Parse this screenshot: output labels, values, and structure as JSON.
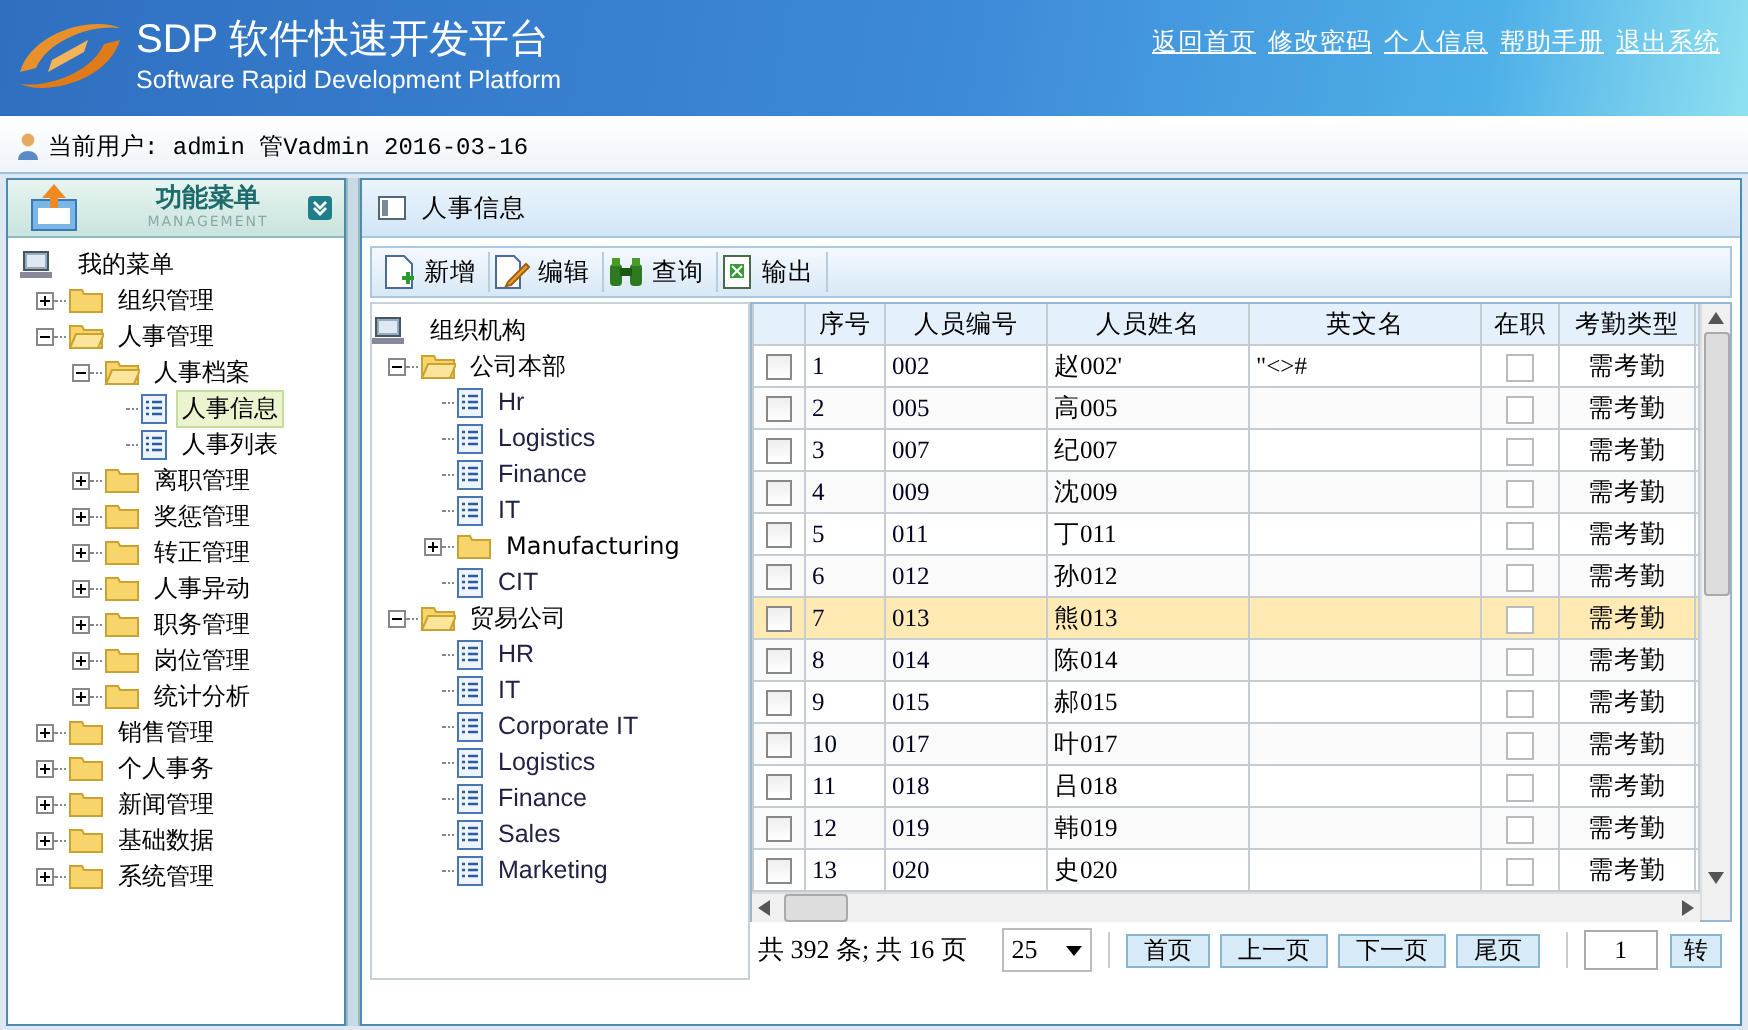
{
  "header": {
    "title": "SDP 软件快速开发平台",
    "subtitle": "Software Rapid Development Platform",
    "links": [
      "返回首页",
      "修改密码",
      "个人信息",
      "帮助手册",
      "退出系统"
    ]
  },
  "user_bar": {
    "text": "当前用户: admin 管Vadmin 2016-03-16"
  },
  "menu": {
    "title": "功能菜单",
    "subtitle": "MANAGEMENT",
    "root": "我的菜单",
    "items": [
      {
        "label": "组织管理",
        "kind": "folder",
        "expanded": false,
        "selected": false
      },
      {
        "label": "人事管理",
        "kind": "folder",
        "expanded": true,
        "selected": false,
        "children": [
          {
            "label": "人事档案",
            "kind": "folder",
            "expanded": true,
            "selected": false,
            "children": [
              {
                "label": "人事信息",
                "kind": "page",
                "selected": true
              },
              {
                "label": "人事列表",
                "kind": "page",
                "selected": false
              }
            ]
          },
          {
            "label": "离职管理",
            "kind": "folder",
            "expanded": false,
            "selected": false
          },
          {
            "label": "奖惩管理",
            "kind": "folder",
            "expanded": false,
            "selected": false
          },
          {
            "label": "转正管理",
            "kind": "folder",
            "expanded": false,
            "selected": false
          },
          {
            "label": "人事异动",
            "kind": "folder",
            "expanded": false,
            "selected": false
          },
          {
            "label": "职务管理",
            "kind": "folder",
            "expanded": false,
            "selected": false
          },
          {
            "label": "岗位管理",
            "kind": "folder",
            "expanded": false,
            "selected": false
          },
          {
            "label": "统计分析",
            "kind": "folder",
            "expanded": false,
            "selected": false
          }
        ]
      },
      {
        "label": "销售管理",
        "kind": "folder",
        "expanded": false,
        "selected": false
      },
      {
        "label": "个人事务",
        "kind": "folder",
        "expanded": false,
        "selected": false
      },
      {
        "label": "新闻管理",
        "kind": "folder",
        "expanded": false,
        "selected": false
      },
      {
        "label": "基础数据",
        "kind": "folder",
        "expanded": false,
        "selected": false
      },
      {
        "label": "系统管理",
        "kind": "folder",
        "expanded": false,
        "selected": false
      }
    ]
  },
  "panel": {
    "title": "人事信息",
    "toolbar": [
      {
        "label": "新增",
        "kind": "add"
      },
      {
        "label": "编辑",
        "kind": "edit"
      },
      {
        "label": "查询",
        "kind": "search"
      },
      {
        "label": "输出",
        "kind": "export"
      }
    ],
    "org_tree": {
      "root": "组织机构",
      "items": [
        {
          "label": "公司本部",
          "kind": "folder",
          "expanded": true,
          "selected": false,
          "children": [
            {
              "label": "Hr",
              "kind": "page",
              "selected": false
            },
            {
              "label": "Logistics",
              "kind": "page",
              "selected": false
            },
            {
              "label": "Finance",
              "kind": "page",
              "selected": false
            },
            {
              "label": "IT",
              "kind": "page",
              "selected": false
            },
            {
              "label": "Manufacturing",
              "kind": "folder",
              "expanded": false,
              "selected": false
            },
            {
              "label": "CIT",
              "kind": "page",
              "selected": false
            }
          ]
        },
        {
          "label": "贸易公司",
          "kind": "folder",
          "expanded": true,
          "selected": false,
          "children": [
            {
              "label": "HR",
              "kind": "page",
              "selected": false
            },
            {
              "label": "IT",
              "kind": "page",
              "selected": false
            },
            {
              "label": "Corporate IT",
              "kind": "page",
              "selected": false
            },
            {
              "label": "Logistics",
              "kind": "page",
              "selected": false
            },
            {
              "label": "Finance",
              "kind": "page",
              "selected": false
            },
            {
              "label": "Sales",
              "kind": "page",
              "selected": false
            },
            {
              "label": "Marketing",
              "kind": "page",
              "selected": false
            }
          ]
        }
      ]
    },
    "table": {
      "columns": [
        "序号",
        "人员编号",
        "人员姓名",
        "英文名",
        "在职",
        "考勤类型"
      ],
      "rows": [
        {
          "no": "1",
          "code": "002",
          "name": "赵002'",
          "english": "\"<>#",
          "active": false,
          "attendance": "需考勤",
          "checked": false,
          "selected": false
        },
        {
          "no": "2",
          "code": "005",
          "name": "高005",
          "active": false,
          "attendance": "需考勤",
          "checked": false,
          "selected": false
        },
        {
          "no": "3",
          "code": "007",
          "name": "纪007",
          "active": false,
          "attendance": "需考勤",
          "checked": false,
          "selected": false
        },
        {
          "no": "4",
          "code": "009",
          "name": "沈009",
          "active": false,
          "attendance": "需考勤",
          "checked": false,
          "selected": false
        },
        {
          "no": "5",
          "code": "011",
          "name": "丁011",
          "active": false,
          "attendance": "需考勤",
          "checked": false,
          "selected": false
        },
        {
          "no": "6",
          "code": "012",
          "name": "孙012",
          "active": false,
          "attendance": "需考勤",
          "checked": false,
          "selected": false
        },
        {
          "no": "7",
          "code": "013",
          "name": "熊013",
          "active": false,
          "attendance": "需考勤",
          "checked": false,
          "selected": true
        },
        {
          "no": "8",
          "code": "014",
          "name": "陈014",
          "active": false,
          "attendance": "需考勤",
          "checked": false,
          "selected": false
        },
        {
          "no": "9",
          "code": "015",
          "name": "郝015",
          "active": false,
          "attendance": "需考勤",
          "checked": false,
          "selected": false
        },
        {
          "no": "10",
          "code": "017",
          "name": "叶017",
          "active": false,
          "attendance": "需考勤",
          "checked": false,
          "selected": false
        },
        {
          "no": "11",
          "code": "018",
          "name": "吕018",
          "active": false,
          "attendance": "需考勤",
          "checked": false,
          "selected": false
        },
        {
          "no": "12",
          "code": "019",
          "name": "韩019",
          "active": false,
          "attendance": "需考勤",
          "checked": false,
          "selected": false
        },
        {
          "no": "13",
          "code": "020",
          "name": "史020",
          "active": false,
          "attendance": "需考勤",
          "checked": false,
          "selected": false
        }
      ]
    },
    "pager": {
      "summary": "共 392 条; 共 16 页",
      "page_size": "25",
      "buttons": [
        "首页",
        "上一页",
        "下一页",
        "尾页"
      ],
      "page": "1",
      "go": "转"
    }
  }
}
